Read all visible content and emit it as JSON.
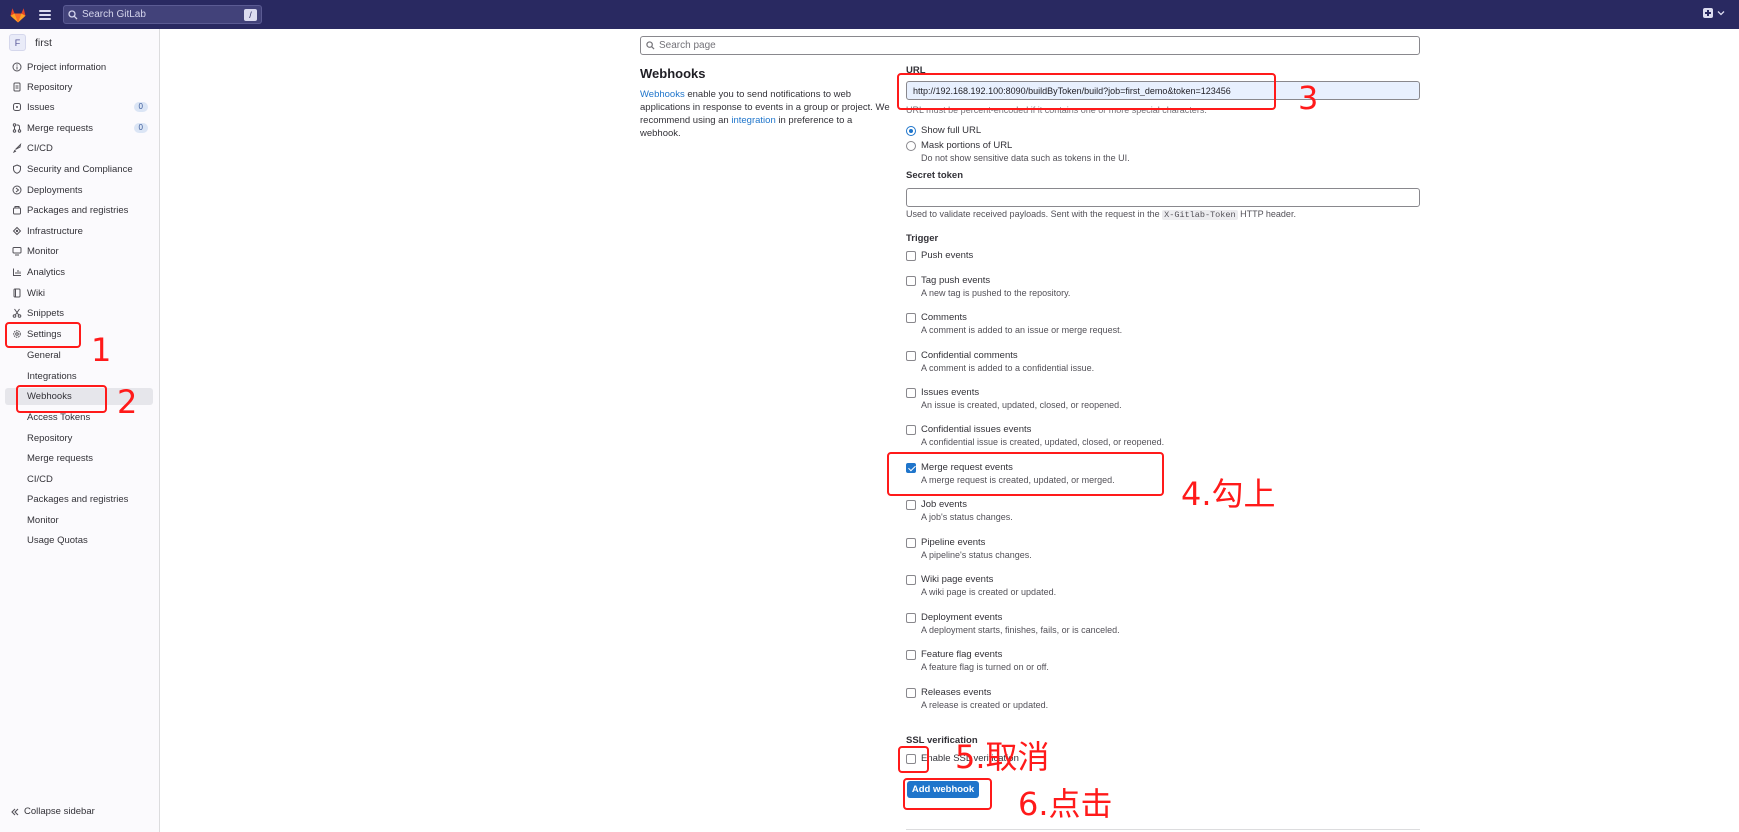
{
  "topbar": {
    "search_placeholder": "Search GitLab",
    "search_shortcut": "/"
  },
  "sidebar": {
    "project_initial": "F",
    "project_name": "first",
    "items": [
      {
        "label": "Project information",
        "icon": "info-icon"
      },
      {
        "label": "Repository",
        "icon": "doc-icon"
      },
      {
        "label": "Issues",
        "icon": "issues-icon",
        "badge": "0"
      },
      {
        "label": "Merge requests",
        "icon": "merge-icon",
        "badge": "0"
      },
      {
        "label": "CI/CD",
        "icon": "rocket-icon"
      },
      {
        "label": "Security and Compliance",
        "icon": "shield-icon"
      },
      {
        "label": "Deployments",
        "icon": "deploy-icon"
      },
      {
        "label": "Packages and registries",
        "icon": "package-icon"
      },
      {
        "label": "Infrastructure",
        "icon": "cloud-icon"
      },
      {
        "label": "Monitor",
        "icon": "monitor-icon"
      },
      {
        "label": "Analytics",
        "icon": "chart-icon"
      },
      {
        "label": "Wiki",
        "icon": "book-icon"
      },
      {
        "label": "Snippets",
        "icon": "scissors-icon"
      },
      {
        "label": "Settings",
        "icon": "gear-icon"
      }
    ],
    "settings_sub": [
      "General",
      "Integrations",
      "Webhooks",
      "Access Tokens",
      "Repository",
      "Merge requests",
      "CI/CD",
      "Packages and registries",
      "Monitor",
      "Usage Quotas"
    ],
    "collapse_label": "Collapse sidebar"
  },
  "main": {
    "search_placeholder": "Search page",
    "title": "Webhooks",
    "desc_link1": "Webhooks",
    "desc_part1": " enable you to send notifications to web applications in response to events in a group or project. We recommend using an ",
    "desc_link2": "integration",
    "desc_part2": " in preference to a webhook.",
    "url_label": "URL",
    "url_value": "http://192.168.192.100:8090/buildByToken/build?job=first_demo&token=123456",
    "url_hint": "URL must be percent-encoded if it contains one or more special characters.",
    "show_full_url": "Show full URL",
    "mask_url": "Mask portions of URL",
    "mask_url_help": "Do not show sensitive data such as tokens in the UI.",
    "secret_label": "Secret token",
    "secret_help_pre": "Used to validate received payloads. Sent with the request in the ",
    "secret_help_code": "X-Gitlab-Token",
    "secret_help_post": " HTTP header.",
    "trigger_label": "Trigger",
    "triggers": [
      {
        "label": "Push events",
        "desc": "",
        "checked": false
      },
      {
        "label": "Tag push events",
        "desc": "A new tag is pushed to the repository.",
        "checked": false
      },
      {
        "label": "Comments",
        "desc": "A comment is added to an issue or merge request.",
        "checked": false
      },
      {
        "label": "Confidential comments",
        "desc": "A comment is added to a confidential issue.",
        "checked": false
      },
      {
        "label": "Issues events",
        "desc": "An issue is created, updated, closed, or reopened.",
        "checked": false
      },
      {
        "label": "Confidential issues events",
        "desc": "A confidential issue is created, updated, closed, or reopened.",
        "checked": false
      },
      {
        "label": "Merge request events",
        "desc": "A merge request is created, updated, or merged.",
        "checked": true
      },
      {
        "label": "Job events",
        "desc": "A job's status changes.",
        "checked": false
      },
      {
        "label": "Pipeline events",
        "desc": "A pipeline's status changes.",
        "checked": false
      },
      {
        "label": "Wiki page events",
        "desc": "A wiki page is created or updated.",
        "checked": false
      },
      {
        "label": "Deployment events",
        "desc": "A deployment starts, finishes, fails, or is canceled.",
        "checked": false
      },
      {
        "label": "Feature flag events",
        "desc": "A feature flag is turned on or off.",
        "checked": false
      },
      {
        "label": "Releases events",
        "desc": "A release is created or updated.",
        "checked": false
      }
    ],
    "ssl_label": "SSL verification",
    "ssl_checkbox": "Enable SSL verification",
    "add_button": "Add webhook"
  },
  "annotations": {
    "a1": "1",
    "a2": "2",
    "a3": "3",
    "a4": "4.勾上",
    "a5": "5.取消",
    "a6": "6.点击"
  },
  "colors": {
    "topbar": "#292961",
    "accent": "#1f75cb",
    "annotation": "#ff1a1a"
  }
}
